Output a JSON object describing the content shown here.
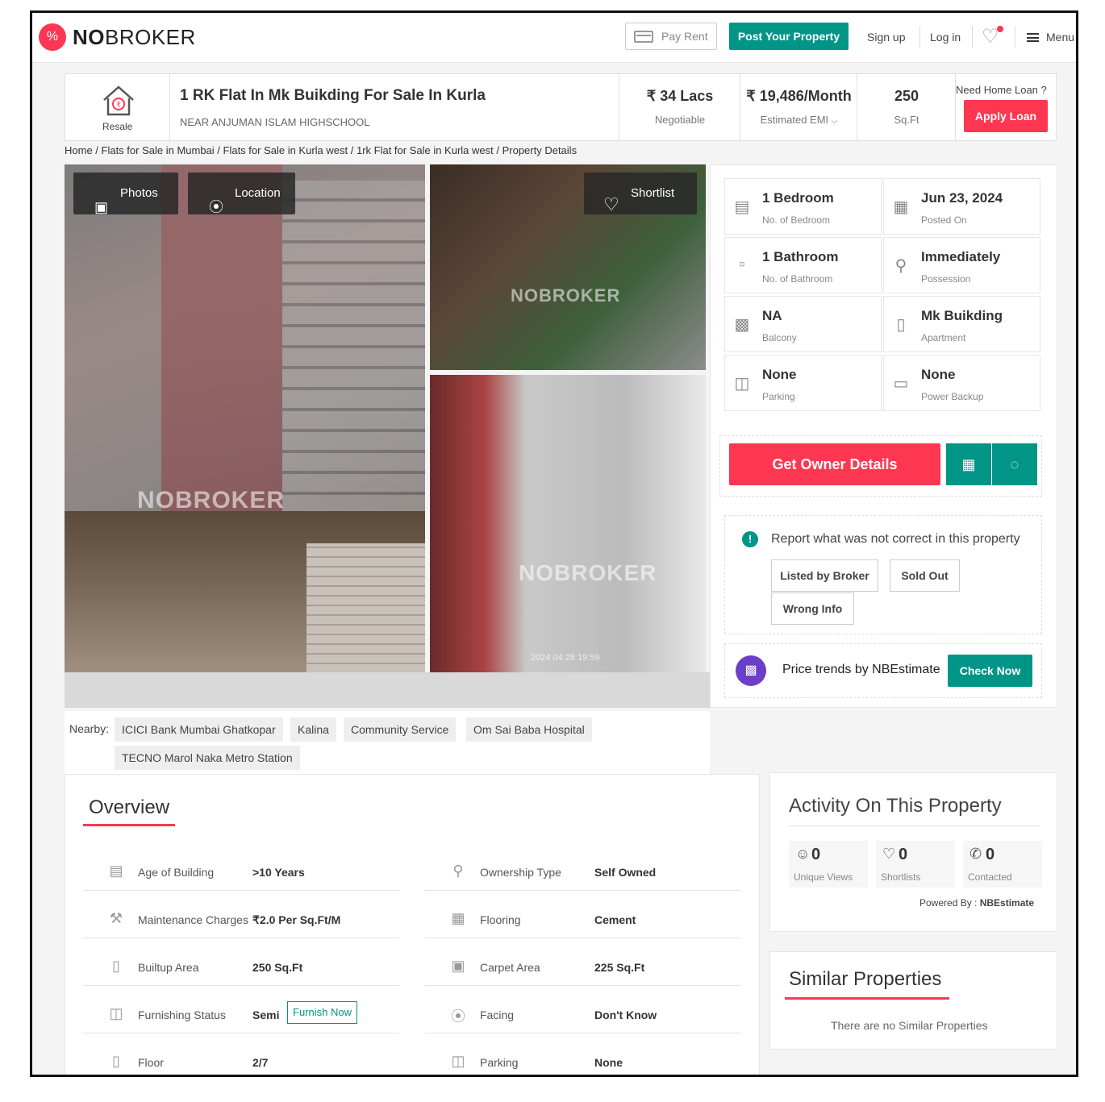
{
  "header": {
    "logo_bold": "NO",
    "logo_light": "BROKER",
    "pay_rent": "Pay Rent",
    "post_property": "Post Your Property",
    "sign_up": "Sign up",
    "log_in": "Log in",
    "menu": "Menu"
  },
  "property": {
    "type_label": "Resale",
    "title": "1 RK Flat In Mk Buikding For Sale In Kurla",
    "subtitle": "NEAR ANJUMAN ISLAM HIGHSCHOOL",
    "price": "₹ 34 Lacs",
    "price_note": "Negotiable",
    "emi": "₹ 19,486/Month",
    "emi_note": "Estimated EMI",
    "area": "250",
    "area_unit": "Sq.Ft",
    "home_loan_q": "Need Home Loan ?",
    "apply_loan": "Apply Loan"
  },
  "breadcrumb": "Home / Flats for Sale in Mumbai / Flats for Sale in Kurla west / 1rk Flat for Sale in Kurla west / Property Details",
  "gallery": {
    "photos": "Photos",
    "location": "Location",
    "shortlist": "Shortlist",
    "watermark": "NOBROKER",
    "ts1": "2024 04 28 19:59",
    "ts2": "2024 04 28 19:59"
  },
  "specs": [
    {
      "value": "1 Bedroom",
      "label": "No. of Bedroom",
      "icon": "bed-icon"
    },
    {
      "value": "Jun 23, 2024",
      "label": "Posted On",
      "icon": "calendar-icon"
    },
    {
      "value": "1 Bathroom",
      "label": "No. of Bathroom",
      "icon": "bath-icon"
    },
    {
      "value": "Immediately",
      "label": "Possession",
      "icon": "key-icon"
    },
    {
      "value": "NA",
      "label": "Balcony",
      "icon": "balcony-icon"
    },
    {
      "value": "Mk Buikding",
      "label": "Apartment",
      "icon": "building-icon"
    },
    {
      "value": "None",
      "label": "Parking",
      "icon": "car-icon"
    },
    {
      "value": "None",
      "label": "Power Backup",
      "icon": "battery-icon"
    }
  ],
  "cta": {
    "get_owner": "Get Owner Details"
  },
  "report": {
    "text": "Report what was not correct in this property",
    "chips": [
      "Listed by Broker",
      "Sold Out",
      "Wrong Info"
    ]
  },
  "trend": {
    "text": "Price trends by NBEstimate",
    "button": "Check Now"
  },
  "nearby": {
    "label": "Nearby:",
    "places": [
      "ICICI Bank Mumbai Ghatkopar",
      "Kalina",
      "Community Service",
      "Om Sai Baba Hospital",
      "TECNO Marol Naka Metro Station"
    ]
  },
  "overview": {
    "title": "Overview",
    "left": [
      {
        "label": "Age of Building",
        "value": ">10 Years"
      },
      {
        "label": "Maintenance Charges",
        "value": "₹2.0 Per Sq.Ft/M"
      },
      {
        "label": "Builtup Area",
        "value": "250 Sq.Ft"
      },
      {
        "label": "Furnishing Status",
        "value": "Semi"
      },
      {
        "label": "Floor",
        "value": "2/7"
      }
    ],
    "right": [
      {
        "label": "Ownership Type",
        "value": "Self Owned"
      },
      {
        "label": "Flooring",
        "value": "Cement"
      },
      {
        "label": "Carpet Area",
        "value": "225 Sq.Ft"
      },
      {
        "label": "Facing",
        "value": "Don't Know"
      },
      {
        "label": "Parking",
        "value": "None"
      }
    ],
    "furnish_now": "Furnish Now"
  },
  "activity": {
    "title": "Activity On This Property",
    "stats": [
      {
        "value": "0",
        "label": "Unique Views"
      },
      {
        "value": "0",
        "label": "Shortlists"
      },
      {
        "value": "0",
        "label": "Contacted"
      }
    ],
    "powered_label": "Powered By :",
    "powered_by": "NBEstimate"
  },
  "similar": {
    "title": "Similar Properties",
    "empty": "There are no Similar Properties"
  },
  "colors": {
    "brand": "#fd3752",
    "accent": "#009587",
    "trend": "#6c3fc8"
  }
}
